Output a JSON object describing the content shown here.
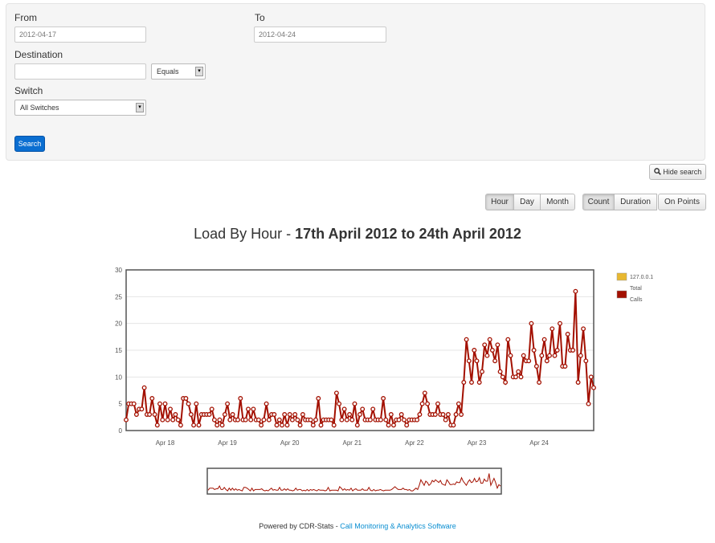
{
  "search": {
    "from_label": "From",
    "from_value": "2012-04-17",
    "to_label": "To",
    "to_value": "2012-04-24",
    "destination_label": "Destination",
    "destination_value": "",
    "match_value": "Equals",
    "switch_label": "Switch",
    "switch_value": "All Switches",
    "search_button": "Search"
  },
  "hide_search_button": "Hide search",
  "period_buttons": [
    "Hour",
    "Day",
    "Month"
  ],
  "active_period": "Hour",
  "metric_buttons": [
    "Count",
    "Duration",
    "On Points"
  ],
  "active_metric": "Count",
  "title_prefix": "Load By Hour - ",
  "title_range": "17th April 2012 to 24th April 2012",
  "legend": [
    {
      "name": "127.0.0.1",
      "color": "#e8b830"
    },
    {
      "name": "Total Calls",
      "color": "#a31000"
    }
  ],
  "footer": {
    "prefix": "Powered by CDR-Stats - ",
    "link": "Call Monitoring & Analytics Software"
  },
  "chart_data": {
    "type": "line",
    "x_tick_labels": [
      "Apr 18",
      "Apr 19",
      "Apr 20",
      "Apr 21",
      "Apr 22",
      "Apr 23",
      "Apr 24"
    ],
    "x_tick_positions_hours": [
      15,
      39,
      63,
      87,
      111,
      135,
      159
    ],
    "ylim": [
      0,
      30
    ],
    "yticks": [
      0,
      5,
      10,
      15,
      20,
      25,
      30
    ],
    "grid": true,
    "legend_position": "right",
    "series": [
      {
        "name": "Total Calls",
        "color": "#a31000",
        "values": [
          2,
          5,
          5,
          5,
          3,
          4,
          4,
          8,
          3,
          3,
          6,
          3,
          1,
          5,
          2,
          5,
          2,
          4,
          2,
          3,
          2,
          1,
          6,
          6,
          5,
          3,
          1,
          5,
          1,
          3,
          3,
          3,
          3,
          4,
          2,
          1,
          2,
          1,
          3,
          5,
          2,
          3,
          2,
          2,
          6,
          2,
          2,
          4,
          2,
          4,
          2,
          2,
          1,
          2,
          5,
          2,
          3,
          3,
          1,
          2,
          1,
          3,
          1,
          3,
          2,
          3,
          2,
          1,
          3,
          2,
          2,
          2,
          1,
          2,
          6,
          1,
          2,
          2,
          2,
          2,
          1,
          7,
          5,
          2,
          4,
          2,
          3,
          2,
          5,
          1,
          3,
          4,
          2,
          2,
          2,
          4,
          2,
          2,
          2,
          6,
          2,
          1,
          3,
          1,
          2,
          2,
          3,
          2,
          1,
          2,
          2,
          2,
          2,
          3,
          5,
          7,
          5,
          3,
          3,
          3,
          5,
          3,
          3,
          2,
          3,
          1,
          1,
          3,
          5,
          3,
          9,
          17,
          13,
          9,
          15,
          13,
          9,
          11,
          16,
          14,
          17,
          15,
          13,
          16,
          11,
          10,
          9,
          17,
          14,
          10,
          10,
          11,
          10,
          14,
          13,
          13,
          20,
          15,
          12,
          9,
          14,
          17,
          13,
          14,
          19,
          14,
          15,
          20,
          12,
          12,
          18,
          15,
          15,
          26,
          9,
          14,
          19,
          13,
          5,
          10,
          8
        ]
      }
    ]
  }
}
